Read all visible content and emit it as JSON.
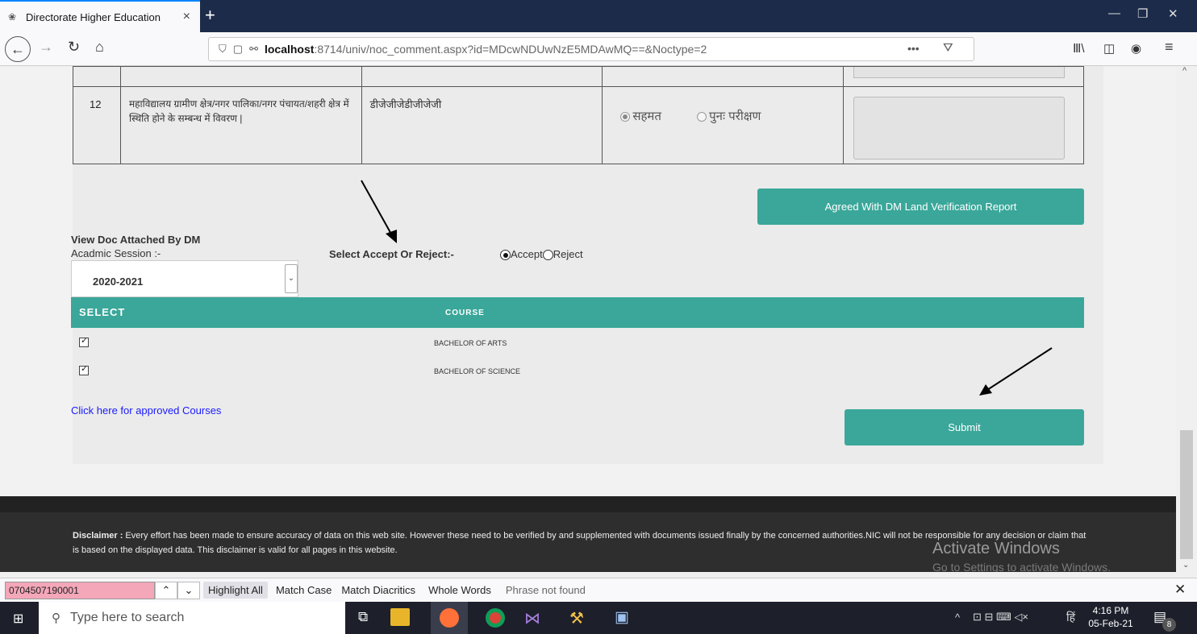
{
  "browser": {
    "tab_title": "Directorate Higher Education",
    "tab_close": "×",
    "new_tab": "+",
    "url_host": "localhost",
    "url_path": ":8714/univ/noc_comment.aspx?id=MDcwNDUwNzE5MDAwMQ==&Noctype=2",
    "url_more": "•••"
  },
  "row12": {
    "num": "12",
    "description": "महाविद्यालय ग्रामीण क्षेत्र/नगर पालिका/नगर पंचायत/शहरी क्षेत्र में स्थिति होने के सम्बन्ध में विवरण |",
    "value": "डीजेजीजेडीजीजेजी",
    "opt_agree": "सहमत",
    "opt_recheck": "पुनः परीक्षण"
  },
  "form": {
    "agreed_button": "Agreed With DM Land Verification  Report",
    "view_doc": "View Doc Attached By DM",
    "session_label": "Acadmic Session :-",
    "session_value": "2020-2021",
    "select_accept_label": "Select Accept Or Reject:-",
    "accept": "Accept",
    "reject": "Reject",
    "approved_link": "Click here for approved Courses",
    "submit": "Submit"
  },
  "courses": {
    "headers": [
      "SELECT",
      "COURSE"
    ],
    "rows": [
      {
        "checked": true,
        "course": "BACHELOR OF ARTS"
      },
      {
        "checked": true,
        "course": "BACHELOR OF SCIENCE"
      }
    ]
  },
  "footer": {
    "disclaimer_label": "Disclaimer :",
    "disclaimer_text": " Every effort has been made to ensure accuracy of data on this web site. However these need to be verified by and supplemented with documents issued finally by the concerned authorities.NIC will not be responsible for any decision or claim that is based on the displayed data. This disclaimer is valid for all pages in this website.",
    "watermark_title": "Activate Windows",
    "watermark_sub": "Go to Settings to activate Windows."
  },
  "findbar": {
    "query": "0704507190001",
    "highlight_all": "Highlight All",
    "match_case": "Match Case",
    "match_diacritics": "Match Diacritics",
    "whole_words": "Whole Words",
    "status": "Phrase not found"
  },
  "taskbar": {
    "search_placeholder": "Type here to search",
    "time": "4:16 PM",
    "date": "05-Feb-21",
    "lang": "हिं",
    "notif_count": "8"
  },
  "colors": {
    "teal": "#3aa79a",
    "link": "#1a1aff",
    "find_query_bg": "#f4a7b9"
  }
}
